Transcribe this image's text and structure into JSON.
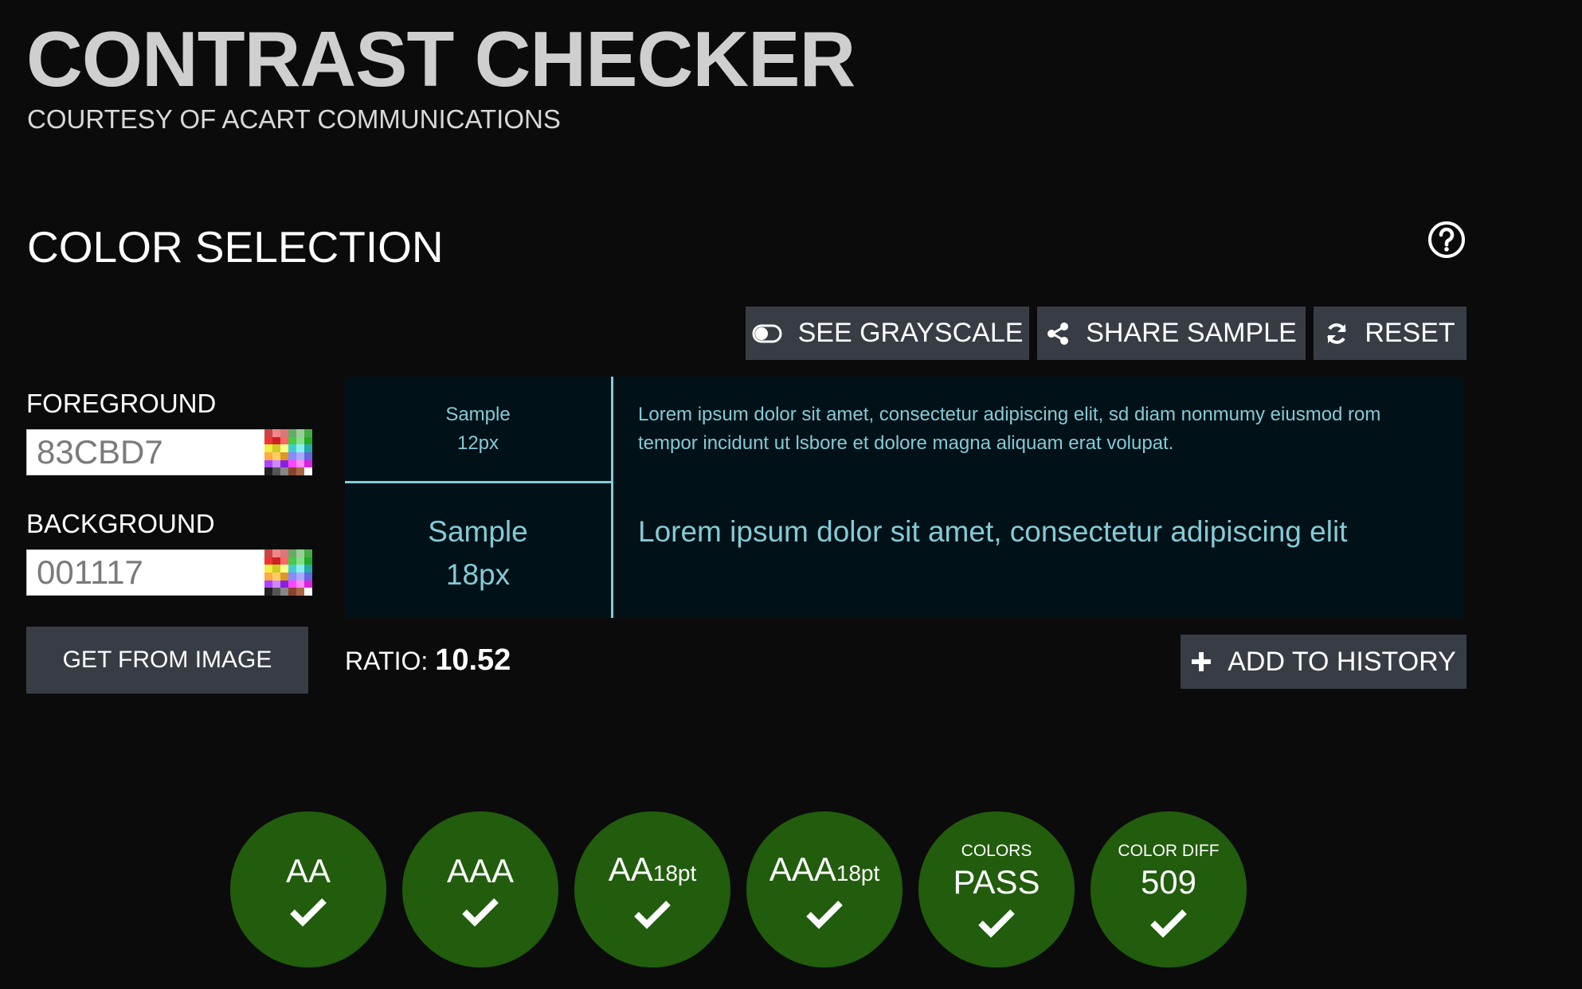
{
  "header": {
    "title": "CONTRAST CHECKER",
    "subtitle": "COURTESY OF ACART COMMUNICATIONS"
  },
  "color_selection": {
    "title": "COLOR SELECTION",
    "help_icon": "question-circle-icon",
    "buttons": {
      "grayscale": {
        "label": "SEE GRAYSCALE",
        "icon": "toggle-icon"
      },
      "share": {
        "label": "SHARE SAMPLE",
        "icon": "share-icon"
      },
      "reset": {
        "label": "RESET",
        "icon": "refresh-icon"
      }
    },
    "foreground": {
      "label": "FOREGROUND",
      "value": "83CBD7",
      "icon": "palette-icon"
    },
    "background": {
      "label": "BACKGROUND",
      "value": "001117",
      "icon": "palette-icon"
    },
    "get_from_image": "GET FROM IMAGE"
  },
  "preview": {
    "sample_small": {
      "line1": "Sample",
      "line2": "12px"
    },
    "sample_large": {
      "line1": "Sample",
      "line2": "18px"
    },
    "lorem_small": "Lorem ipsum dolor sit amet, consectetur adipiscing elit, sd diam nonmumy eiusmod rom tempor incidunt ut lsbore et dolore magna aliquam erat volupat.",
    "lorem_large": "Lorem ipsum dolor sit amet, consectetur adipiscing elit",
    "foreground_color": "#83cbd7",
    "background_color": "#001117"
  },
  "ratio": {
    "label": "RATIO:",
    "value": "10.52"
  },
  "add_to_history": {
    "label": "ADD TO HISTORY",
    "icon": "plus-icon"
  },
  "results": [
    {
      "top": "",
      "main": "AA",
      "sub": "",
      "status": "check-icon"
    },
    {
      "top": "",
      "main": "AAA",
      "sub": "",
      "status": "check-icon"
    },
    {
      "top": "",
      "main": "AA",
      "sub": "18pt",
      "status": "check-icon"
    },
    {
      "top": "",
      "main": "AAA",
      "sub": "18pt",
      "status": "check-icon"
    },
    {
      "top": "COLORS",
      "main": "PASS",
      "sub": "",
      "status": "check-icon"
    },
    {
      "top": "COLOR DIFF",
      "main": "509",
      "sub": "",
      "status": "check-icon"
    }
  ],
  "colors": {
    "page_bg": "#0b0b0b",
    "button_bg": "#383d45",
    "pass_green": "#215d0c",
    "title_gray": "#cfcfcf"
  }
}
